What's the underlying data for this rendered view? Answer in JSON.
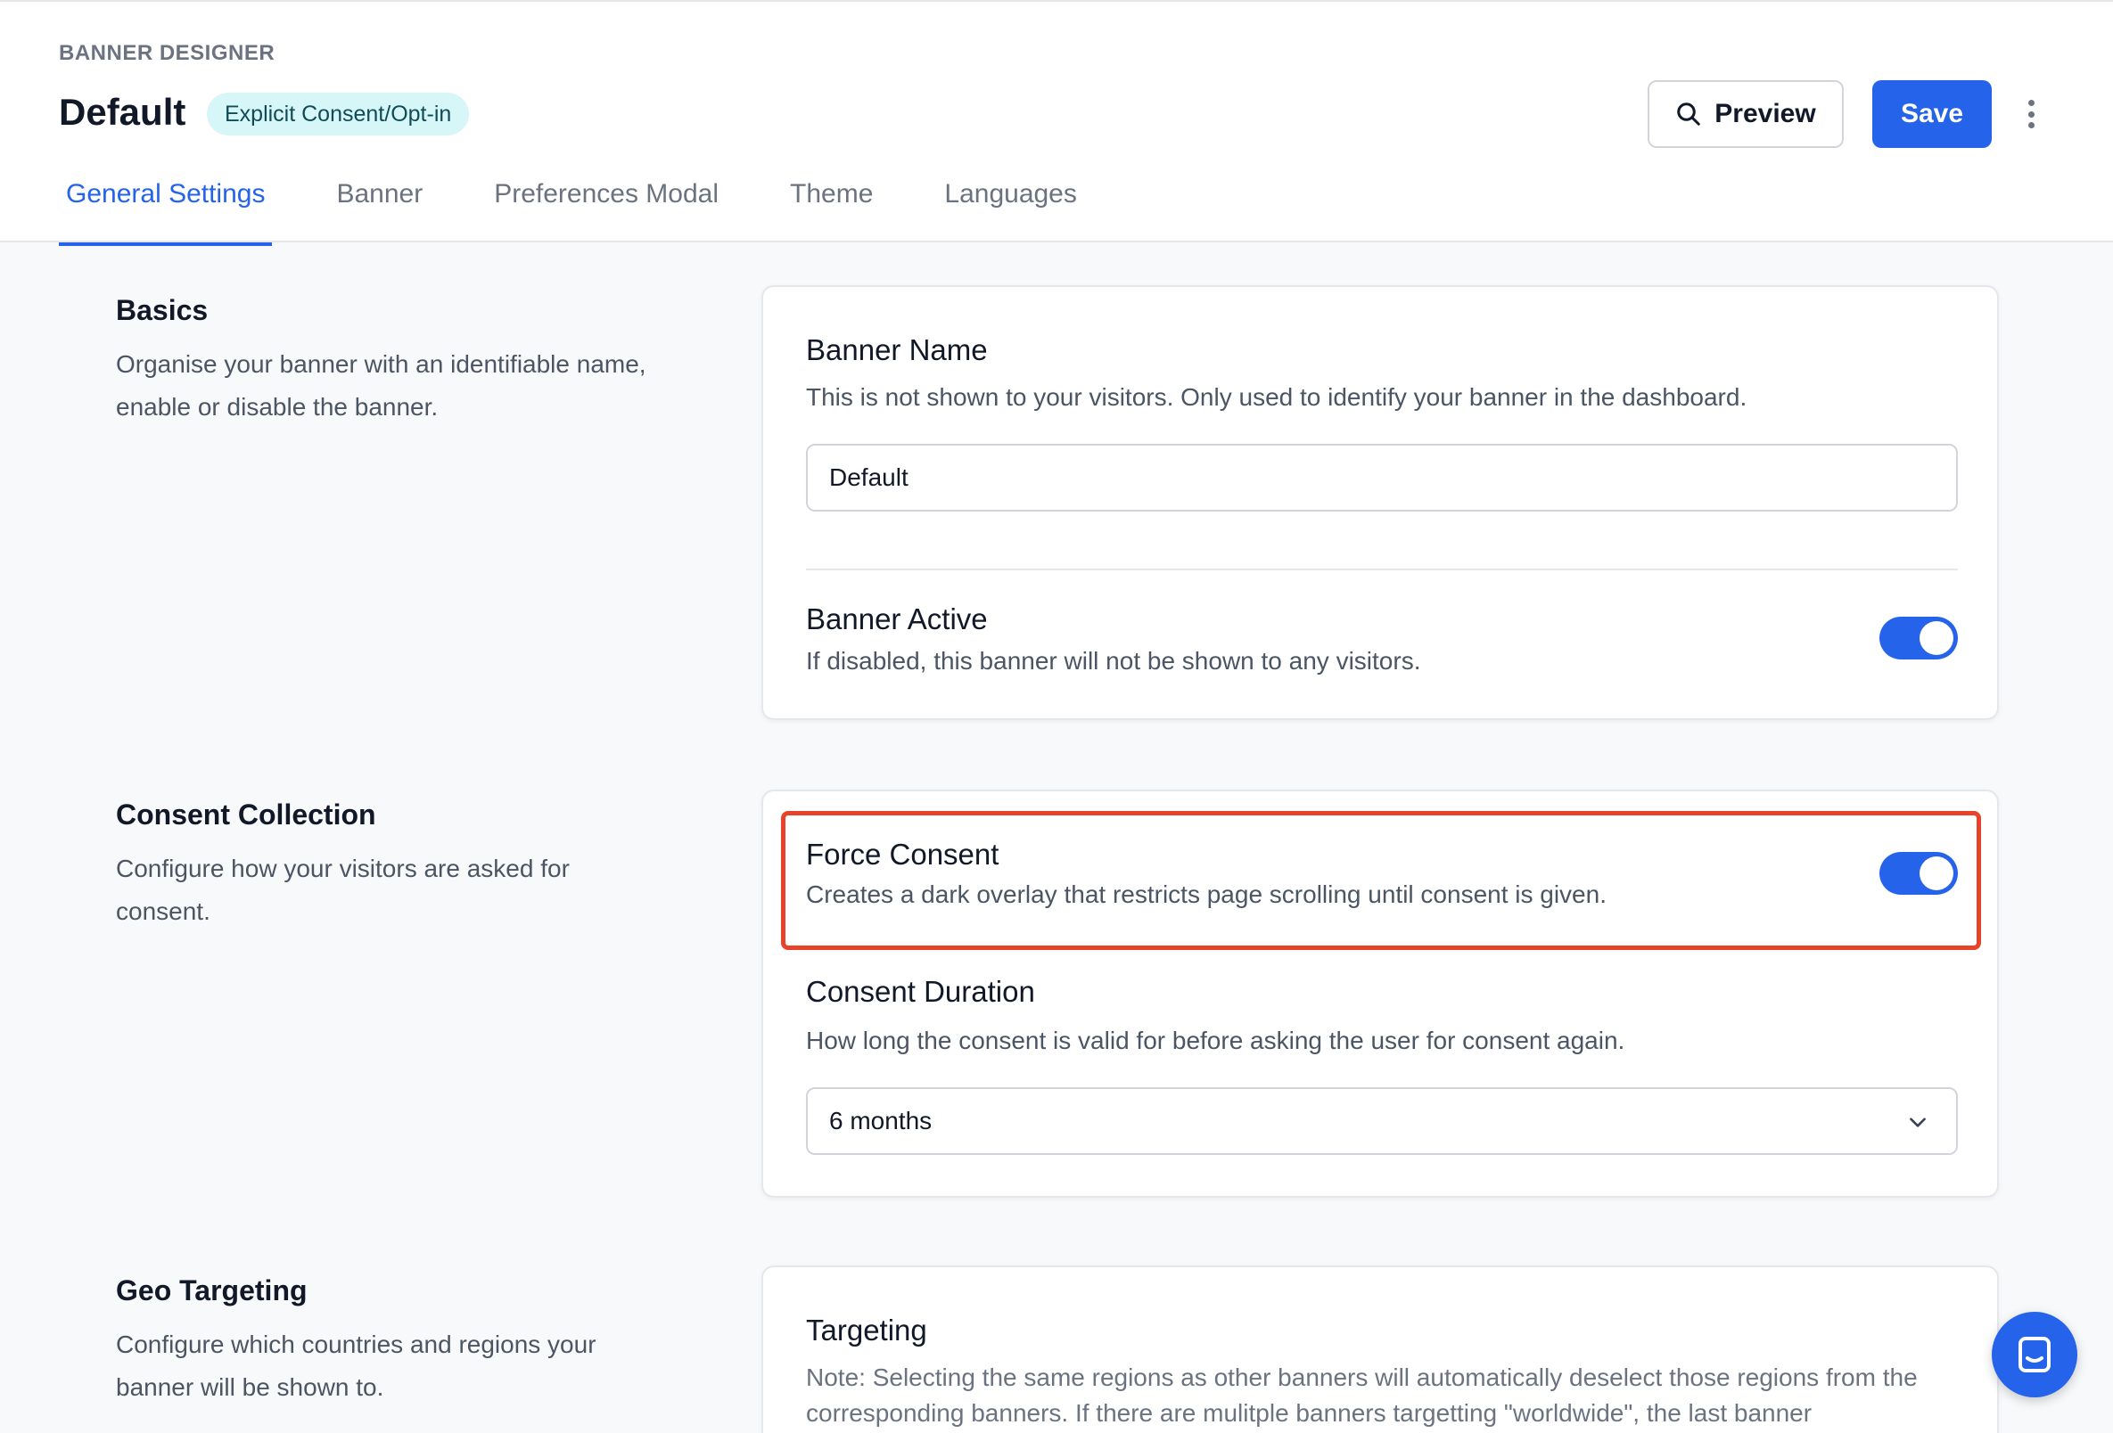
{
  "header": {
    "eyebrow": "BANNER DESIGNER",
    "title": "Default",
    "badge": "Explicit Consent/Opt-in",
    "preview_label": "Preview",
    "save_label": "Save"
  },
  "tabs": [
    {
      "label": "General Settings",
      "active": true
    },
    {
      "label": "Banner",
      "active": false
    },
    {
      "label": "Preferences Modal",
      "active": false
    },
    {
      "label": "Theme",
      "active": false
    },
    {
      "label": "Languages",
      "active": false
    }
  ],
  "sections": {
    "basics": {
      "title": "Basics",
      "description": "Organise your banner with an identifiable name, enable or disable the banner.",
      "banner_name": {
        "label": "Banner Name",
        "description": "This is not shown to your visitors. Only used to identify your banner in the dashboard.",
        "value": "Default"
      },
      "banner_active": {
        "label": "Banner Active",
        "description": "If disabled, this banner will not be shown to any visitors.",
        "enabled": true
      }
    },
    "consent": {
      "title": "Consent Collection",
      "description": "Configure how your visitors are asked for consent.",
      "force_consent": {
        "label": "Force Consent",
        "description": "Creates a dark overlay that restricts page scrolling until consent is given.",
        "enabled": true
      },
      "duration": {
        "label": "Consent Duration",
        "description": "How long the consent is valid for before asking the user for consent again.",
        "value": "6 months"
      }
    },
    "geo": {
      "title": "Geo Targeting",
      "description": "Configure which countries and regions your banner will be shown to.",
      "targeting": {
        "label": "Targeting",
        "note": "Note: Selecting the same regions as other banners will automatically deselect those regions from the corresponding banners. If there are mulitple banners targetting \"worldwide\", the last banner"
      }
    }
  },
  "colors": {
    "accent": "#2563eb",
    "highlight": "#e8432a",
    "badge_bg": "#d7f6f8"
  },
  "icons": [
    "search-icon",
    "kebab-menu-icon",
    "chevron-down-icon",
    "chat-icon"
  ]
}
